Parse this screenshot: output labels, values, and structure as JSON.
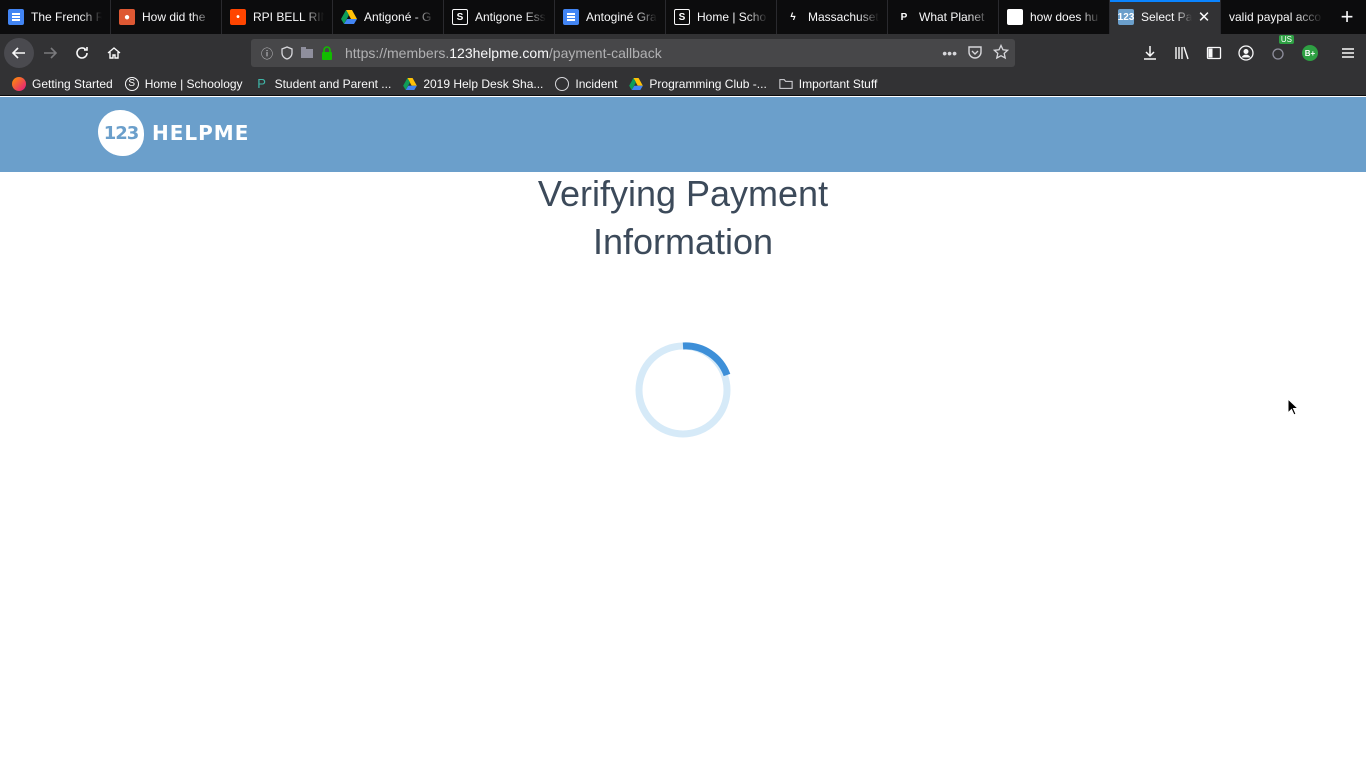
{
  "browser": {
    "tabs": [
      {
        "title": "The French R",
        "favicon": "docs-icon"
      },
      {
        "title": "How did the",
        "favicon": "duckduckgo-icon"
      },
      {
        "title": "RPI BELL RIN",
        "favicon": "reddit-icon"
      },
      {
        "title": "Antigoné - G",
        "favicon": "drive-icon"
      },
      {
        "title": "Antigone Ess",
        "favicon": "schoology-icon"
      },
      {
        "title": "Antoginé Gra",
        "favicon": "docs-icon"
      },
      {
        "title": "Home | Scho",
        "favicon": "schoology-icon"
      },
      {
        "title": "Massachuset",
        "favicon": "bolt-icon"
      },
      {
        "title": "What Planet",
        "favicon": "p-icon"
      },
      {
        "title": "how does hu",
        "favicon": "google-icon"
      },
      {
        "title": "Select Pa",
        "favicon": "123helpme-icon",
        "active": true
      },
      {
        "title": "valid paypal acco",
        "favicon": ""
      }
    ],
    "url": {
      "prefix": "https://members.",
      "host": "123helpme.com",
      "path": "/payment-callback"
    },
    "addon_badges": {
      "us": "US",
      "b": "B+"
    },
    "bookmarks": [
      {
        "label": "Getting Started",
        "icon": "firefox-icon"
      },
      {
        "label": "Home | Schoology",
        "icon": "schoology-icon"
      },
      {
        "label": "Student and Parent ...",
        "icon": "p-icon"
      },
      {
        "label": "2019 Help Desk Sha...",
        "icon": "drive-icon"
      },
      {
        "label": "Incident",
        "icon": "globe-icon"
      },
      {
        "label": "Programming Club -...",
        "icon": "drive-icon"
      },
      {
        "label": "Important Stuff",
        "icon": "folder-icon"
      }
    ]
  },
  "site": {
    "logo_number": "123",
    "logo_text": "HELPME",
    "header_color": "#6b9fcb"
  },
  "main": {
    "title_line1": "Verifying Payment",
    "title_line2": "Information",
    "spinner_state": "loading"
  }
}
